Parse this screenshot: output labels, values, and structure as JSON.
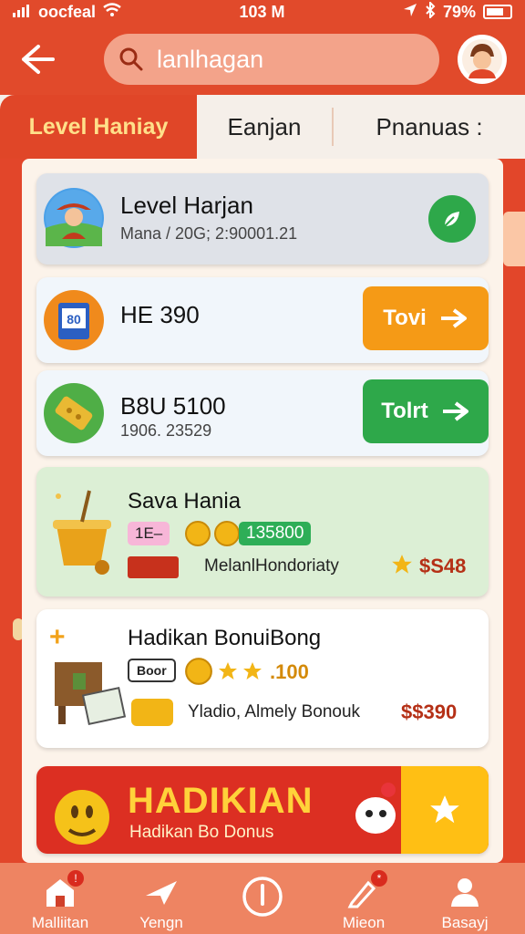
{
  "status_bar": {
    "carrier": "oocfeal",
    "time": "103 M",
    "battery": "79%"
  },
  "header": {
    "search_value": "lanlhagan",
    "search_placeholder": "lanlhagan"
  },
  "tabs": [
    {
      "label": "Level Haniay",
      "active": true
    },
    {
      "label": "Eanjan",
      "active": false
    },
    {
      "label": "Pnanuas :",
      "active": false
    }
  ],
  "cards": {
    "level": {
      "title": "Level Harjan",
      "subtitle": "Mana / 20G; 2:90001.21"
    },
    "item1": {
      "title": "HE 390",
      "button": "Tovi"
    },
    "item2": {
      "title": "B8U 5100",
      "subtitle": "1906. 23529",
      "button": "Tolrt"
    },
    "offer1": {
      "title": "Sava Hania",
      "chip_label": "1E–",
      "chip_value": "135800",
      "desc": "MelanlHondoriaty",
      "price": "$S48"
    },
    "offer2": {
      "title": "Hadikan BonuiBong",
      "chip_label": "Boor",
      "chip_value": ".100",
      "desc": "Yladio, Almely Bonouk",
      "price": "$$390"
    },
    "banner": {
      "title": "HADIKIAN",
      "subtitle": "Hadikan Bo Donus"
    }
  },
  "bottom_nav": [
    {
      "label": "Malliitan",
      "badge": "!"
    },
    {
      "label": "Yengn",
      "badge": ""
    },
    {
      "label": "",
      "badge": ""
    },
    {
      "label": "Mieon",
      "badge": "*"
    },
    {
      "label": "Basayj",
      "badge": ""
    }
  ],
  "colors": {
    "brand": "#e14a2b",
    "orange_button": "#f59a16",
    "green_button": "#2ea84a",
    "tab_active_text": "#ffe08a",
    "banner_yellow": "#ffbf14"
  },
  "icons": {
    "status": [
      "signal-icon",
      "wifi-icon",
      "location-icon",
      "bluetooth-icon",
      "battery-icon"
    ],
    "header": [
      "back-arrow-icon",
      "search-icon",
      "bag-icon",
      "avatar"
    ],
    "nav": [
      "shop-icon",
      "plane-icon",
      "power-icon",
      "pen-icon",
      "user-icon"
    ]
  }
}
